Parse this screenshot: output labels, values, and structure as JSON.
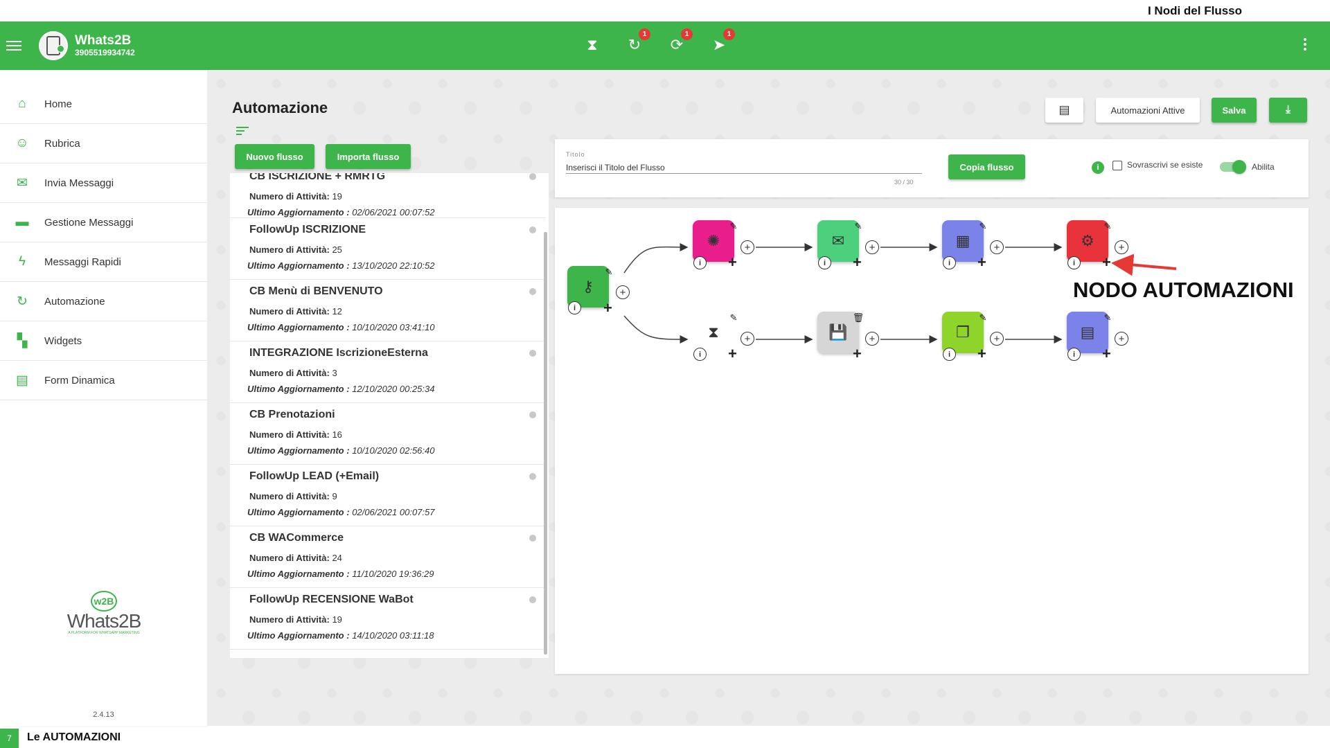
{
  "slide": {
    "title": "I Nodi del Flusso",
    "page_number": "7",
    "footer_label": "Le AUTOMAZIONI"
  },
  "header": {
    "app_name": "Whats2B",
    "phone": "3905519934742",
    "icons": [
      {
        "name": "hourglass-icon",
        "glyph": "⧗",
        "badge": ""
      },
      {
        "name": "refresh-clock-icon",
        "glyph": "↻",
        "badge": "1"
      },
      {
        "name": "sync-icon",
        "glyph": "⟳",
        "badge": "1"
      },
      {
        "name": "scheduled-send-icon",
        "glyph": "➤",
        "badge": "1"
      }
    ],
    "accent_color": "#3db54a"
  },
  "sidebar": {
    "items": [
      {
        "label": "Home",
        "icon": "home-icon"
      },
      {
        "label": "Rubrica",
        "icon": "contacts-icon"
      },
      {
        "label": "Invia Messaggi",
        "icon": "mail-icon"
      },
      {
        "label": "Gestione Messaggi",
        "icon": "folder-icon"
      },
      {
        "label": "Messaggi Rapidi",
        "icon": "lightning-icon"
      },
      {
        "label": "Automazione",
        "icon": "automation-icon"
      },
      {
        "label": "Widgets",
        "icon": "widgets-icon"
      },
      {
        "label": "Form Dinamica",
        "icon": "form-icon"
      }
    ],
    "logo_text": "Whats2B",
    "logo_circle": "w2B",
    "logo_tagline": "A PLATFORM FOR WHATSAPP MARKETING",
    "version": "2.4.13"
  },
  "main": {
    "page_title": "Automazione",
    "new_flow_label": "Nuovo flusso",
    "import_flow_label": "Importa flusso",
    "active_automations_label": "Automazioni Attive",
    "save_label": "Salva",
    "title_field": {
      "label": "Titolo",
      "value": "Inserisci il Titolo del Flusso",
      "counter": "30 / 30"
    },
    "copy_flow_label": "Copia flusso",
    "overwrite_label": "Sovrascrivi se esiste",
    "enable_label": "Abilita",
    "activity_label": "Numero di Attività:",
    "update_label": "Ultimo Aggiornamento :",
    "flows": [
      {
        "name": "CB ISCRIZIONE + RMRTG",
        "count": "19",
        "updated": "02/06/2021 00:07:52"
      },
      {
        "name": "FollowUp ISCRIZIONE",
        "count": "25",
        "updated": "13/10/2020 22:10:52"
      },
      {
        "name": "CB Menù di BENVENUTO",
        "count": "12",
        "updated": "10/10/2020 03:41:10"
      },
      {
        "name": "INTEGRAZIONE IscrizioneEsterna",
        "count": "3",
        "updated": "12/10/2020 00:25:34"
      },
      {
        "name": "CB Prenotazioni",
        "count": "16",
        "updated": "10/10/2020 02:56:40"
      },
      {
        "name": "FollowUp LEAD (+Email)",
        "count": "9",
        "updated": "02/06/2021 00:07:57"
      },
      {
        "name": "CB WACommerce",
        "count": "24",
        "updated": "11/10/2020 19:36:29"
      },
      {
        "name": "FollowUp RECENSIONE WaBot",
        "count": "19",
        "updated": "14/10/2020 03:11:18"
      }
    ]
  },
  "canvas": {
    "annotation": "NODO AUTOMAZIONI",
    "nodes": [
      {
        "id": "trigger",
        "icon": "key-icon",
        "glyph": "⚷",
        "color": "#3db54a"
      },
      {
        "id": "chatbot",
        "icon": "brain-icon",
        "glyph": "✺",
        "color": "#e91e8c"
      },
      {
        "id": "email",
        "icon": "envelope-icon",
        "glyph": "✉",
        "color": "#4cd07d"
      },
      {
        "id": "calendar",
        "icon": "calendar-icon",
        "glyph": "▦",
        "color": "#7c83e8"
      },
      {
        "id": "automation",
        "icon": "robot-icon",
        "glyph": "⚙",
        "color": "#e8323c"
      },
      {
        "id": "wait",
        "icon": "hourglass-icon",
        "glyph": "⧗",
        "color": "#ffffff"
      },
      {
        "id": "save",
        "icon": "floppy-icon",
        "glyph": "💾",
        "color": "#d6d6d6"
      },
      {
        "id": "documents",
        "icon": "documents-icon",
        "glyph": "❐",
        "color": "#8fd42a"
      },
      {
        "id": "form",
        "icon": "form-node-icon",
        "glyph": "▤",
        "color": "#7c83e8"
      }
    ]
  }
}
